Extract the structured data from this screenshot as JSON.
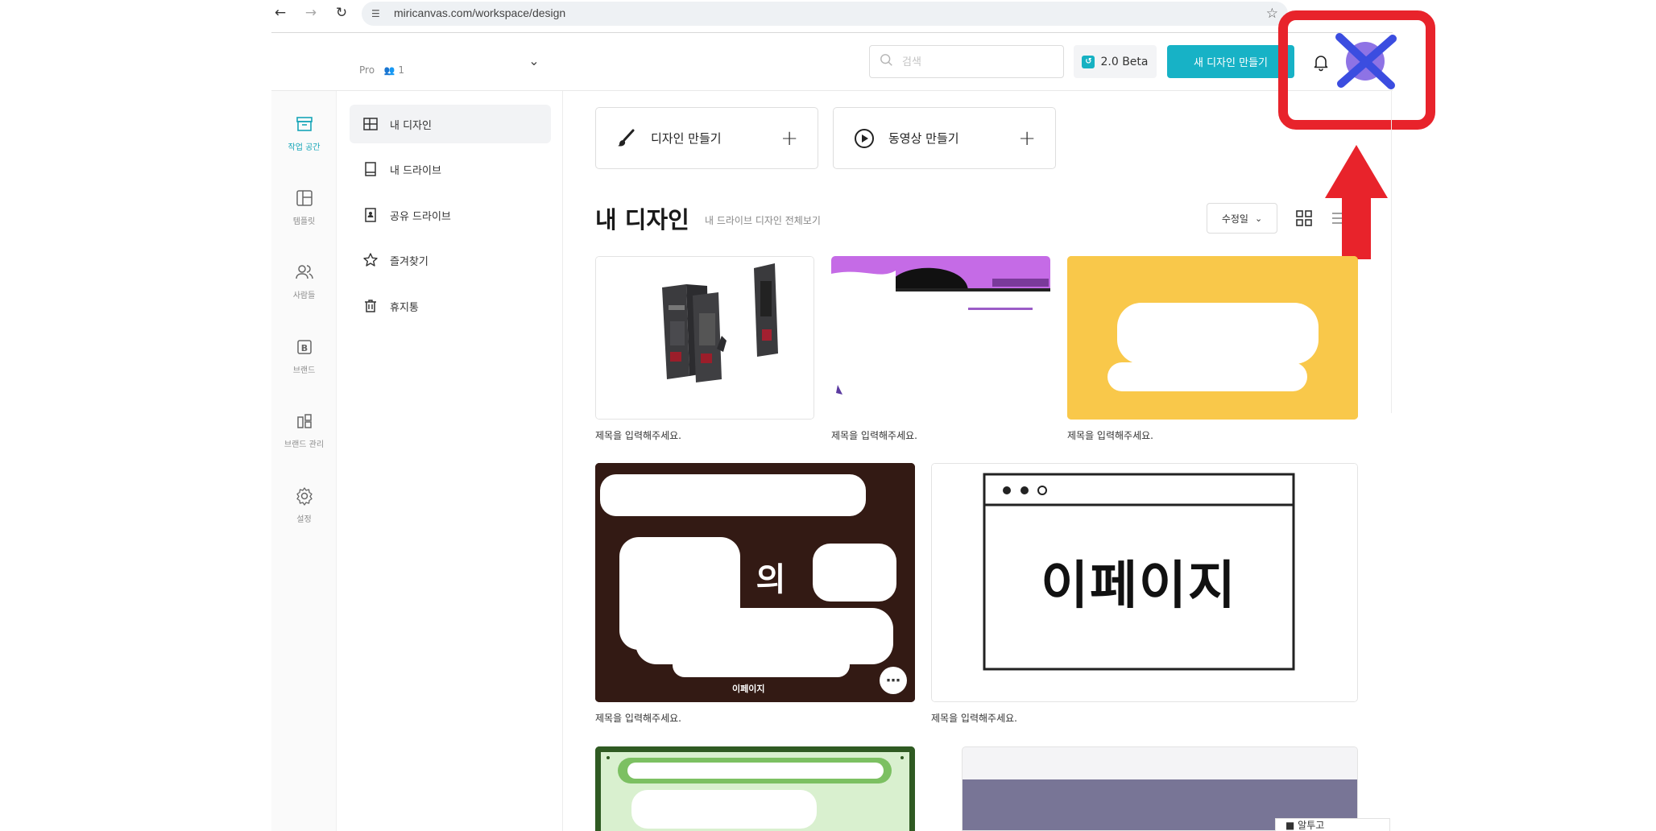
{
  "browser": {
    "url": "miricanvas.com/workspace/design"
  },
  "header": {
    "plan_label": "Pro",
    "member_count": "1",
    "search_placeholder": "검색",
    "beta_label": "2.0 Beta",
    "new_design_label": "새 디자인 만들기"
  },
  "rail": {
    "items": [
      {
        "label": "작업 공간",
        "icon": "archive-box-icon"
      },
      {
        "label": "템플릿",
        "icon": "layout-template-icon"
      },
      {
        "label": "사람들",
        "icon": "people-icon"
      },
      {
        "label": "브랜드",
        "icon": "brand-b-icon"
      },
      {
        "label": "브랜드 관리",
        "icon": "brand-manage-icon"
      },
      {
        "label": "설정",
        "icon": "gear-icon"
      }
    ]
  },
  "sidenav": {
    "items": [
      {
        "label": "내 디자인",
        "icon": "grid-layout-icon"
      },
      {
        "label": "내 드라이브",
        "icon": "drive-icon"
      },
      {
        "label": "공유 드라이브",
        "icon": "shared-drive-icon"
      },
      {
        "label": "즐겨찾기",
        "icon": "star-outline-icon"
      },
      {
        "label": "휴지통",
        "icon": "trash-icon"
      }
    ]
  },
  "main": {
    "create_design_label": "디자인 만들기",
    "create_video_label": "동영상 만들기",
    "section_title": "내 디자인",
    "section_link": "내 드라이브 디자인 전체보기",
    "sort_label": "수정일",
    "designs": [
      {
        "title": "제목을 입력해주세요."
      },
      {
        "title": "제목을 입력해주세요."
      },
      {
        "title": "제목을 입력해주세요."
      },
      {
        "title": "제목을 입력해주세요.",
        "thumb_caption": "이페이지",
        "overlay_word": "의"
      },
      {
        "title": "제목을 입력해주세요.",
        "thumb_text": "이페이지"
      }
    ]
  },
  "help": {
    "label": "알투고"
  },
  "colors": {
    "accent": "#17b2c6",
    "annotation": "#e8232b"
  }
}
